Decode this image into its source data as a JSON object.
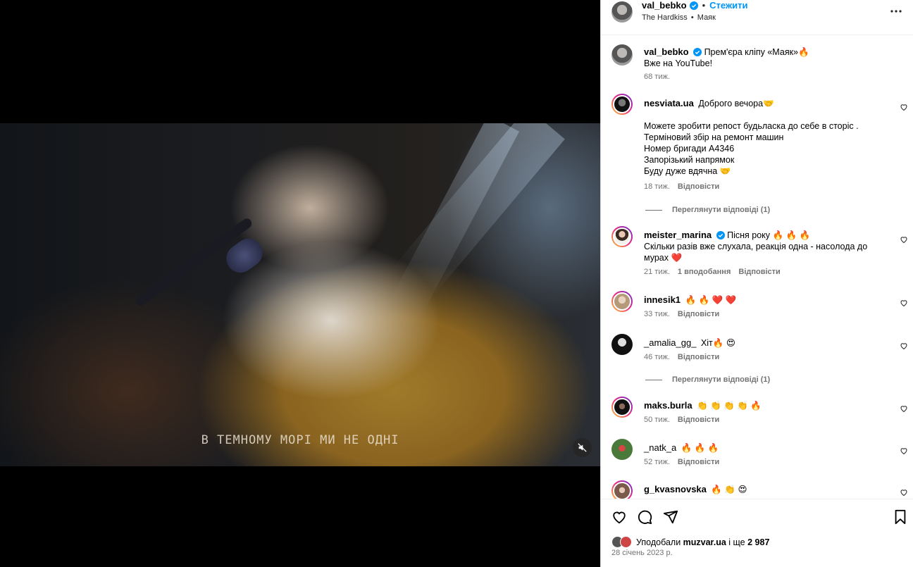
{
  "media": {
    "lyrics": "В ТЕМНОМУ МОРІ МИ НЕ ОДНІ"
  },
  "header": {
    "username": "val_bebko",
    "separator": "•",
    "follow_label": "Стежити",
    "subtitle_artist": "The Hardkiss",
    "subtitle_song": "Маяк"
  },
  "caption": {
    "username": "val_bebko",
    "line1": "Прем'єра кліпу «Маяк»🔥",
    "line2": "Вже на YouTube!",
    "time": "68 тиж."
  },
  "comments": [
    {
      "username": "nesviata.ua",
      "text": "Доброго вечора🤝",
      "extra": [
        "Можете зробити репост будьласка до себе в сторіс .",
        "Терміновий збір на ремонт машин",
        "Номер бригади А4346",
        "Запорізький напрямок",
        "Буду дуже вдячна 🤝"
      ],
      "time": "18 тиж.",
      "reply": "Відповісти"
    },
    {
      "username": "meister_marina",
      "text": "Пісня року 🔥 🔥 🔥",
      "text2": "Скільки разів вже слухала, реакція одна - насолода до мурах ❤️",
      "time": "21 тиж.",
      "likes": "1 вподобання",
      "reply": "Відповісти"
    },
    {
      "username": "innesik1",
      "text": "🔥 🔥 ❤️ ❤️",
      "time": "33 тиж.",
      "reply": "Відповісти"
    },
    {
      "username": "_amalia_gg_",
      "text": "Хіт🔥 😍",
      "time": "46 тиж.",
      "reply": "Відповісти"
    },
    {
      "username": "maks.burla",
      "text": "👏 👏 👏 👏 🔥",
      "time": "50 тиж.",
      "reply": "Відповісти"
    },
    {
      "username": "_natk_a",
      "text": "🔥 🔥 🔥",
      "time": "52 тиж.",
      "reply": "Відповісти"
    },
    {
      "username": "g_kvasnovska",
      "text": "🔥 👏 😍"
    }
  ],
  "view_replies_1": "Переглянути відповіді (1)",
  "view_replies_2": "Переглянути відповіді (1)",
  "footer": {
    "liked_by_prefix": "Уподобали",
    "liked_by_user": "muzvar.ua",
    "liked_by_suffix": "і ще",
    "liked_count": "2 987",
    "date": "28 січень 2023 р."
  },
  "colors": {
    "accent": "#0095f6",
    "muted": "#737373",
    "verified": "#0095f6"
  },
  "icons": [
    "mute-icon",
    "verified-icon",
    "more-icon",
    "heart-icon",
    "comment-icon",
    "share-icon",
    "bookmark-icon"
  ]
}
